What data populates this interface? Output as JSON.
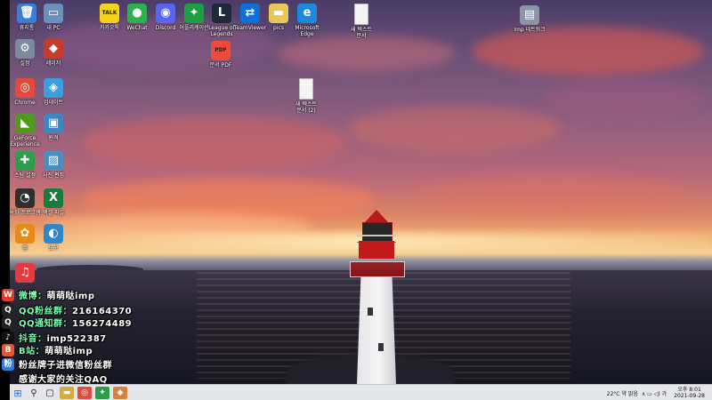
{
  "desktop": {
    "icons": [
      {
        "name": "recycle-bin-icon",
        "label": "휴지통",
        "glyph": "🗑",
        "bg": "#3c7dd9"
      },
      {
        "name": "pc-icon",
        "label": "내 PC",
        "glyph": "▭",
        "bg": "#6a8fbf"
      },
      {
        "name": "kakaotalk-icon",
        "label": "카카오톡",
        "glyph": "TALK",
        "bg": "#f7d21b"
      },
      {
        "name": "wechat-icon",
        "label": "WeChat",
        "glyph": "●",
        "bg": "#2ab34a"
      },
      {
        "name": "discord-icon",
        "label": "Discord",
        "glyph": "◉",
        "bg": "#5865f2"
      },
      {
        "name": "game-launcher-icon",
        "label": "어플리케이션",
        "glyph": "✦",
        "bg": "#1f9f45"
      },
      {
        "name": "league-icon",
        "label": "League of\nLegends",
        "glyph": "L",
        "bg": "#1c2a3a"
      },
      {
        "name": "teamviewer-icon",
        "label": "TeamViewer",
        "glyph": "⇄",
        "bg": "#0e6fd9"
      },
      {
        "name": "folder-icon",
        "label": "pics",
        "glyph": "▬",
        "bg": "#e8c65a"
      },
      {
        "name": "edge-icon",
        "label": "Microsoft\nEdge",
        "glyph": "e",
        "bg": "#1b8ad9"
      },
      {
        "name": "text-file-icon",
        "label": "새 텍스트\n문서",
        "glyph": "",
        "bg": "#f4f4f4"
      },
      {
        "name": "network-drive-icon",
        "label": "imp 네트워크",
        "glyph": "▤",
        "bg": "#8a96a6"
      },
      {
        "name": "gear-icon",
        "label": "설정",
        "glyph": "⚙",
        "bg": "#7a8aa0"
      },
      {
        "name": "game-icon",
        "label": "레이저",
        "glyph": "◆",
        "bg": "#c83a2a"
      },
      {
        "name": "pdf-icon",
        "label": "문서 PDF",
        "glyph": "PDF",
        "bg": "#e94b3c"
      },
      {
        "name": "chrome-icon",
        "label": "Chrome",
        "glyph": "◎",
        "bg": "#e24b3b"
      },
      {
        "name": "downloader-icon",
        "label": "업데이트",
        "glyph": "◈",
        "bg": "#3a9ee0"
      },
      {
        "name": "text-file-2-icon",
        "label": "새 텍스트\n문서 (2)",
        "glyph": "",
        "bg": "#f4f4f4"
      },
      {
        "name": "nvidia-icon",
        "label": "GeForce\nExperience",
        "glyph": "◣",
        "bg": "#4f9a1a"
      },
      {
        "name": "monitor-icon",
        "label": "원격",
        "glyph": "▣",
        "bg": "#3d86c6"
      },
      {
        "name": "app-green-icon",
        "label": "스팀 설정",
        "glyph": "✚",
        "bg": "#2f9e4c"
      },
      {
        "name": "photo-icon",
        "label": "사진 편집",
        "glyph": "▨",
        "bg": "#4a8ec2"
      },
      {
        "name": "obs-style-icon",
        "label": "녹화 프로그램",
        "glyph": "◔",
        "bg": "#2f2f2f"
      },
      {
        "name": "excel-icon",
        "label": "엑셀 파일",
        "glyph": "X",
        "bg": "#1d7a3f"
      },
      {
        "name": "app-orange-icon",
        "label": "앱",
        "glyph": "✿",
        "bg": "#e68a1a"
      },
      {
        "name": "app-blue-icon",
        "label": "도구",
        "glyph": "◐",
        "bg": "#2f86c8"
      },
      {
        "name": "netease-music-icon",
        "label": "",
        "glyph": "♫",
        "bg": "#e23b3b"
      }
    ]
  },
  "overlay": {
    "rows": [
      {
        "name": "weibo-row",
        "icon": "weibo-icon",
        "glyph": "W",
        "icon_bg": "#e03a2c",
        "key": "微博：",
        "value": "萌萌哒imp"
      },
      {
        "name": "fan-group-row",
        "icon": "qq-icon",
        "glyph": "Q",
        "icon_bg": "#222",
        "key": "QQ粉丝群：",
        "value": "216164370"
      },
      {
        "name": "notice-group-row",
        "icon": "qq2-icon",
        "glyph": "Q",
        "icon_bg": "#222",
        "key": "QQ通知群：",
        "value": "156274489"
      },
      {
        "name": "douyin-row",
        "icon": "douyin-icon",
        "glyph": "♪",
        "icon_bg": "#111",
        "key": "抖音：",
        "value": "imp522387"
      },
      {
        "name": "bilibili-row",
        "icon": "bilibili-icon",
        "glyph": "B",
        "icon_bg": "#e4572e",
        "key": "B站：",
        "value": "萌萌哒imp"
      },
      {
        "name": "fan-message-row",
        "icon": "fans-icon",
        "glyph": "粉",
        "icon_bg": "#2e7de1",
        "key": "",
        "value": "粉丝牌子进微信粉丝群"
      },
      {
        "name": "thanks-row",
        "icon": "",
        "glyph": "",
        "icon_bg": "transparent",
        "key": "",
        "value": "感谢大家的关注QAQ"
      }
    ]
  },
  "taskbar": {
    "start_glyph": "⊞",
    "search_glyph": "⚲",
    "taskview_glyph": "▢",
    "apps": [
      {
        "name": "taskbar-explorer-icon",
        "glyph": "▬",
        "bg": "#d9a93a"
      },
      {
        "name": "taskbar-chrome-icon",
        "glyph": "◎",
        "bg": "#e24b3b"
      },
      {
        "name": "taskbar-green-app-icon",
        "glyph": "✦",
        "bg": "#2a9e45"
      },
      {
        "name": "taskbar-orange-app-icon",
        "glyph": "◆",
        "bg": "#d8823a"
      }
    ],
    "weather": "22°C 약 맑음",
    "tray_icons": "∧ ▭ ◁) 가",
    "time": "오후 8:01",
    "date": "2021-09-28"
  }
}
